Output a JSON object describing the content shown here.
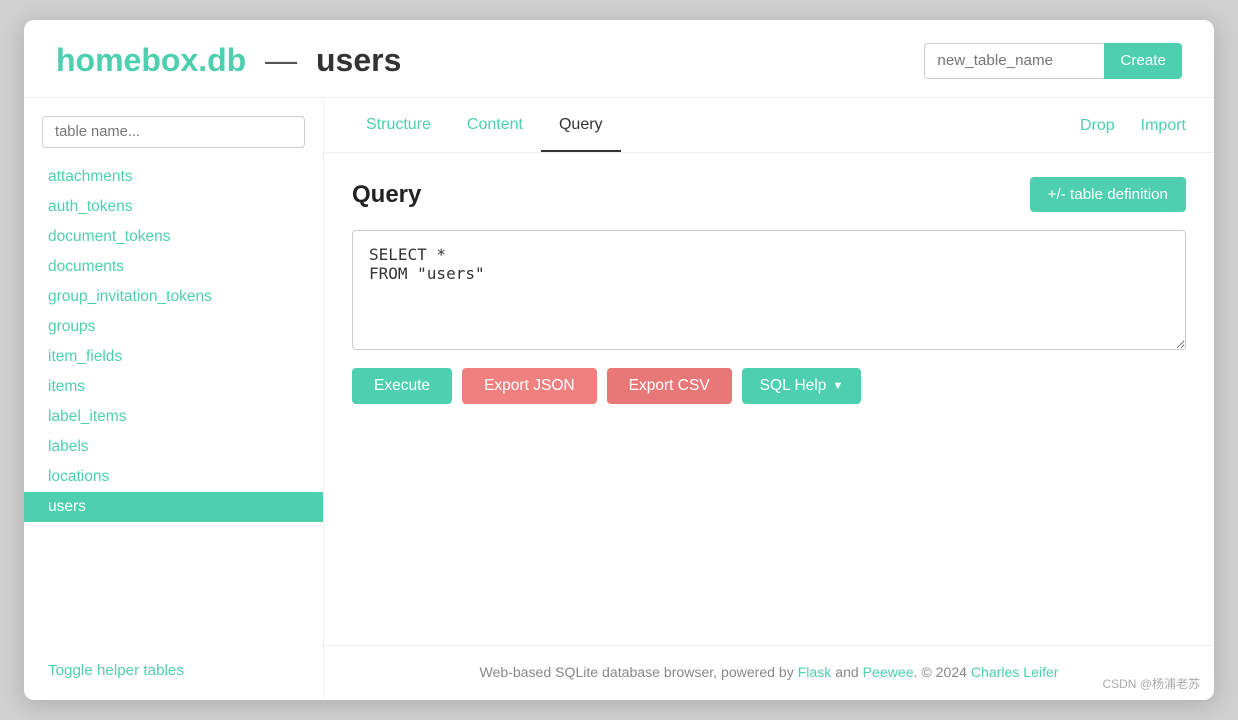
{
  "app": {
    "brand": "homebox.db",
    "separator": "—",
    "current_table": "users",
    "title": "homebox.db — users"
  },
  "header": {
    "new_table_placeholder": "new_table_name",
    "create_label": "Create"
  },
  "sidebar": {
    "search_placeholder": "table name...",
    "tables": [
      {
        "label": "attachments",
        "active": false
      },
      {
        "label": "auth_tokens",
        "active": false
      },
      {
        "label": "document_tokens",
        "active": false
      },
      {
        "label": "documents",
        "active": false
      },
      {
        "label": "group_invitation_tokens",
        "active": false
      },
      {
        "label": "groups",
        "active": false
      },
      {
        "label": "item_fields",
        "active": false
      },
      {
        "label": "items",
        "active": false
      },
      {
        "label": "label_items",
        "active": false
      },
      {
        "label": "labels",
        "active": false
      },
      {
        "label": "locations",
        "active": false
      },
      {
        "label": "users",
        "active": true
      }
    ],
    "toggle_helper_label": "Toggle helper tables"
  },
  "tabs": {
    "items": [
      {
        "label": "Structure",
        "active": false
      },
      {
        "label": "Content",
        "active": false
      },
      {
        "label": "Query",
        "active": true
      }
    ],
    "actions": [
      {
        "label": "Drop"
      },
      {
        "label": "Import"
      }
    ]
  },
  "query": {
    "title": "Query",
    "table_def_btn": "+/- table definition",
    "sql": "SELECT *\nFROM \"users\"",
    "buttons": {
      "execute": "Execute",
      "export_json": "Export JSON",
      "export_csv": "Export CSV",
      "sql_help": "SQL Help"
    }
  },
  "footer": {
    "text_before_flask": "Web-based SQLite database browser, powered by ",
    "flask": "Flask",
    "text_between": " and ",
    "peewee": "Peewee",
    "text_after_peewee": ". © 2024 ",
    "author": "Charles Leifer"
  },
  "watermark": "CSDN @杨浦老苏"
}
